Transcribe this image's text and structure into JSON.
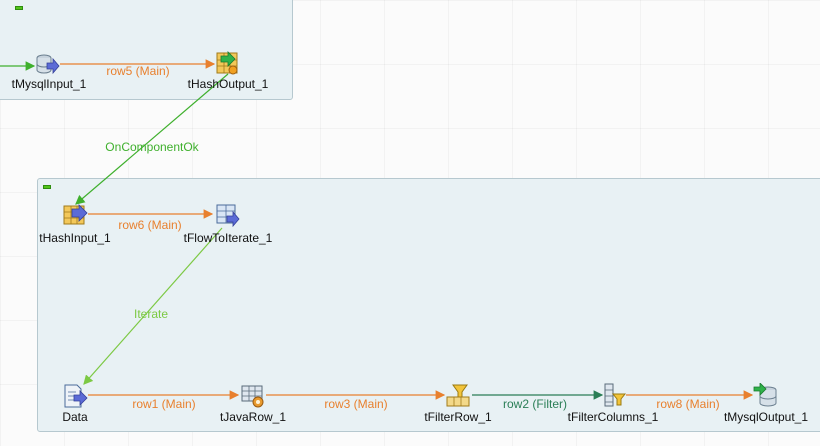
{
  "components": {
    "mysql_input": "tMysqlInput_1",
    "hash_output": "tHashOutput_1",
    "hash_input": "tHashInput_1",
    "flow_to_iterate": "tFlowToIterate_1",
    "data": "Data",
    "java_row": "tJavaRow_1",
    "filter_row": "tFilterRow_1",
    "filter_columns": "tFilterColumns_1",
    "mysql_output": "tMysqlOutput_1"
  },
  "links": {
    "row5": "row5 (Main)",
    "on_component_ok": "OnComponentOk",
    "row6": "row6 (Main)",
    "iterate": "Iterate",
    "row1": "row1 (Main)",
    "row3": "row3 (Main)",
    "row2": "row2 (Filter)",
    "row8": "row8 (Main)"
  },
  "colors": {
    "main_link": "#e8802e",
    "trigger_link": "#3fb02d",
    "iterate_link": "#7cc943",
    "filter_link": "#2a7e56",
    "subjob_bg": "#e8f1f4"
  },
  "icons": {
    "mysql_input": "database-input-icon",
    "hash_output": "hash-output-icon",
    "hash_input": "hash-input-icon",
    "flow_to_iterate": "flow-to-iterate-icon",
    "data": "file-input-icon",
    "java_row": "java-row-icon",
    "filter_row": "filter-icon",
    "filter_columns": "filter-columns-icon",
    "mysql_output": "database-output-icon"
  }
}
